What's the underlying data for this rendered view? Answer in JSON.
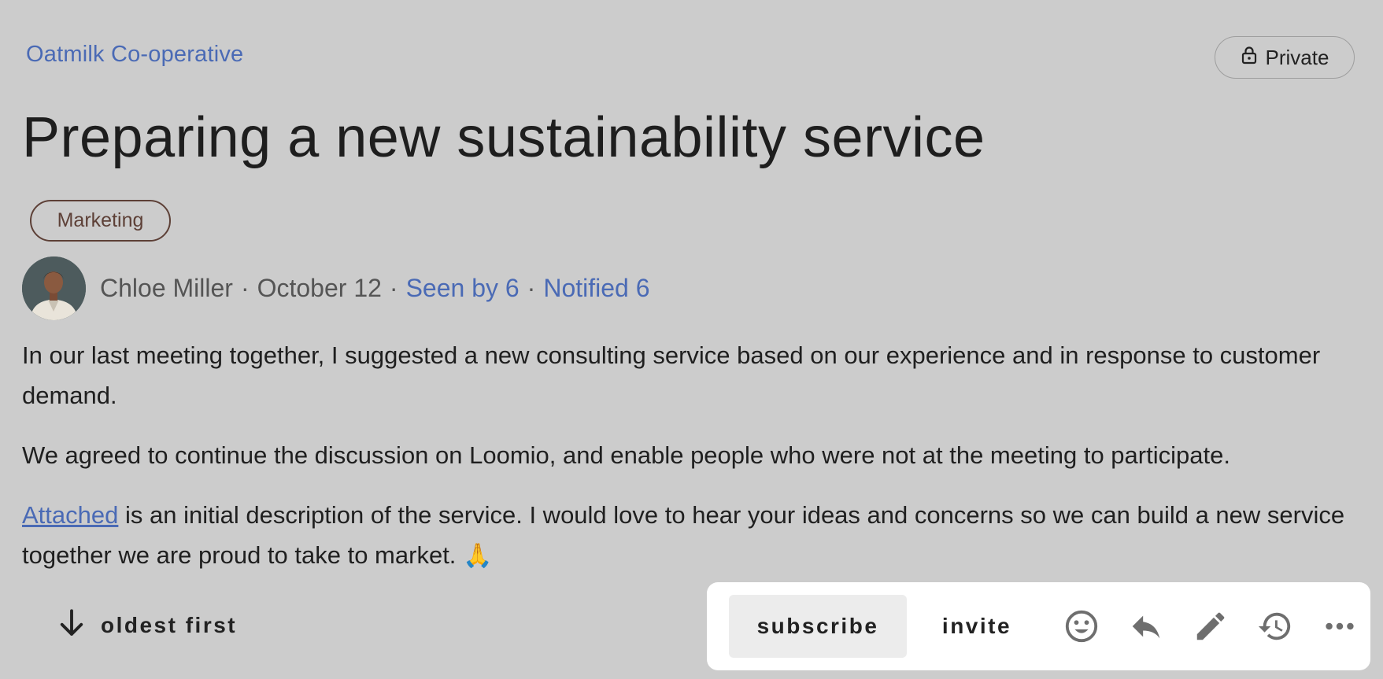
{
  "group": {
    "name": "Oatmilk Co-operative"
  },
  "privacy": {
    "label": "Private",
    "icon": "lock-icon"
  },
  "discussion": {
    "title": "Preparing a new sustainability service",
    "tag": "Marketing",
    "author": "Chloe Miller",
    "date": "October 12",
    "seen_by": "Seen by 6",
    "notified": "Notified 6",
    "separator": "·",
    "paragraphs": [
      "In our last meeting together, I suggested a new consulting service based on our experience and in response to customer demand.",
      "We agreed to continue the discussion on Loomio, and enable people who were not at the meeting to participate."
    ],
    "attached_link": "Attached",
    "last_paragraph_rest": " is an initial description of the service. I would love to hear your ideas and concerns so we can build a new service together we are proud to take to market. ",
    "last_paragraph_emoji": "🙏"
  },
  "sort": {
    "label": "oldest first",
    "icon": "arrow-down-icon"
  },
  "actions": {
    "subscribe": "subscribe",
    "invite": "invite",
    "icons": [
      "emoji-icon",
      "reply-icon",
      "edit-icon",
      "history-icon",
      "more-icon"
    ]
  },
  "colors": {
    "background": "#cccccc",
    "link": "#4a6ab5",
    "tag_border": "#5d4037",
    "action_bar": "#ffffff"
  }
}
